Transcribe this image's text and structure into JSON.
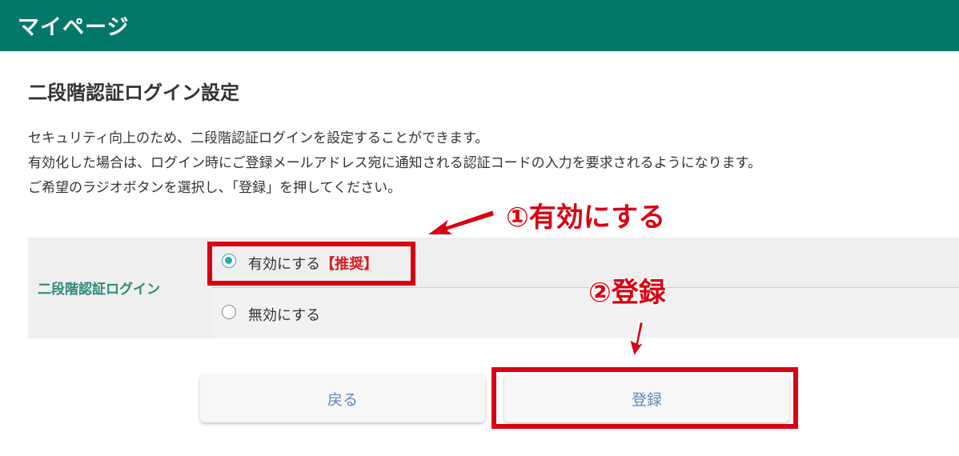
{
  "header": {
    "title": "マイページ"
  },
  "page": {
    "title": "二段階認証ログイン設定",
    "description": [
      "セキュリティ向上のため、二段階認証ログインを設定することができます。",
      "有効化した場合は、ログイン時にご登録メールアドレス宛に通知される認証コードの入力を要求されるようになります。",
      "ご希望のラジオボタンを選択し、「登録」を押してください。"
    ]
  },
  "setting": {
    "label": "二段階認証ログイン",
    "options": [
      {
        "label": "有効にする",
        "badge": "【推奨】",
        "checked": true
      },
      {
        "label": "無効にする",
        "badge": "",
        "checked": false
      }
    ]
  },
  "buttons": {
    "back": "戻る",
    "register": "登録"
  },
  "annotations": {
    "step1": "①有効にする",
    "step2": "②登録"
  },
  "colors": {
    "header_bg": "#02786a",
    "label": "#2e8b78",
    "radio_checked": "#2aa7b8",
    "annotation": "#d90012",
    "button_text": "#5d86b8"
  }
}
